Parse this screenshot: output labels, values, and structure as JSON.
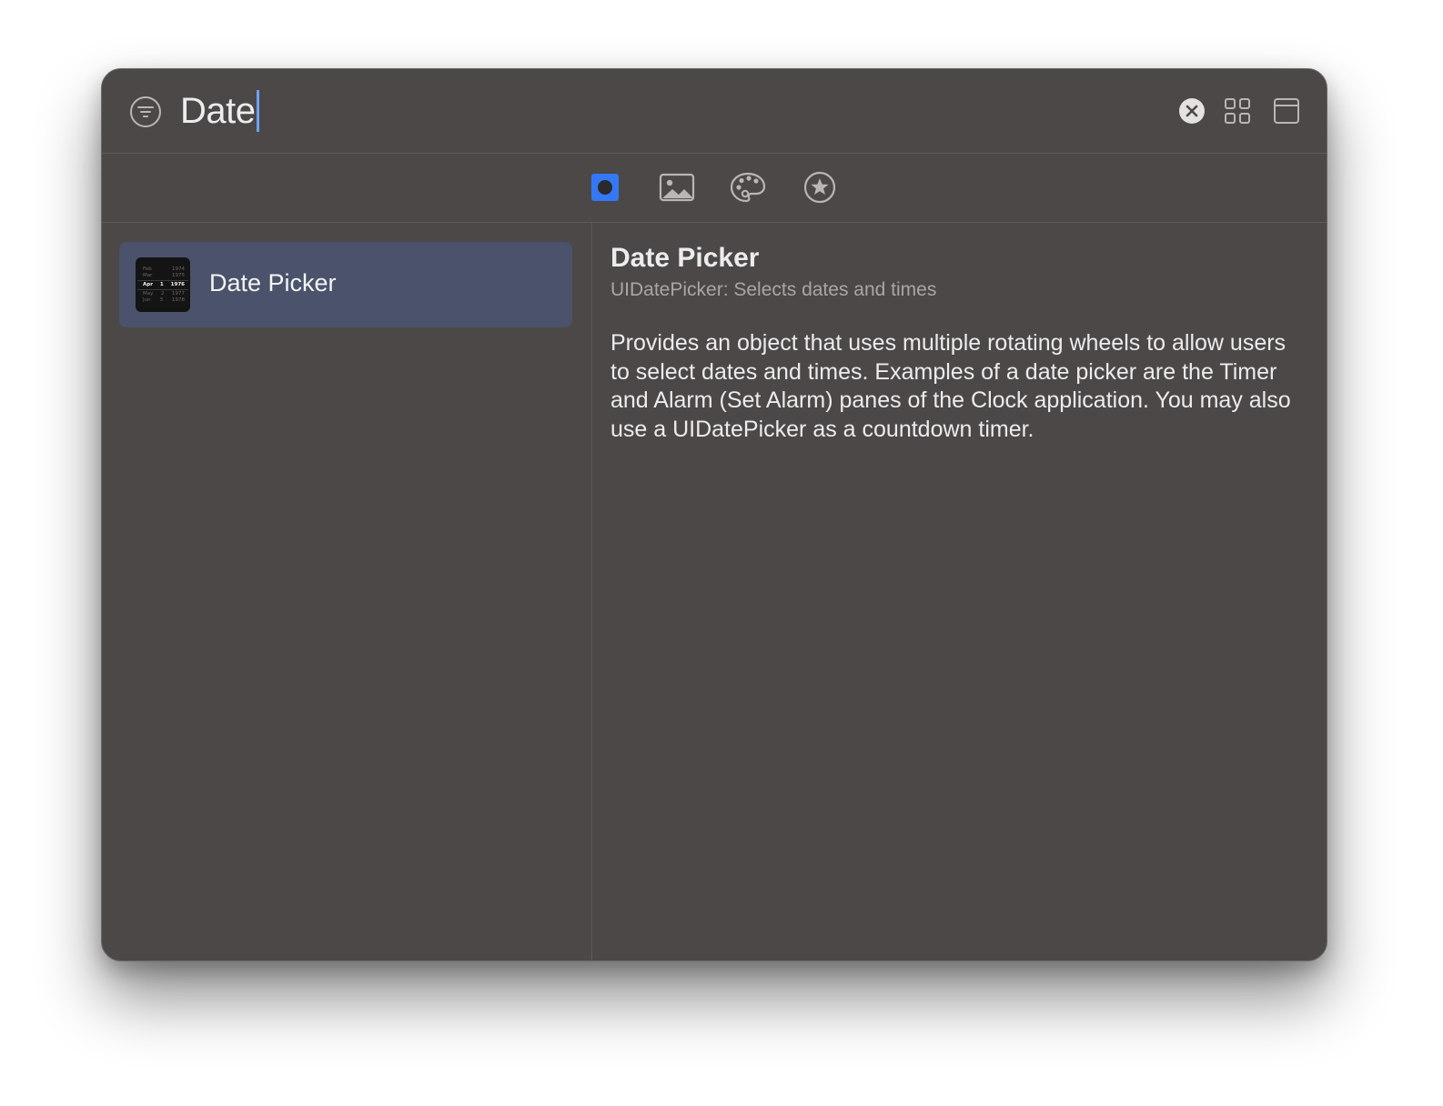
{
  "search": {
    "value": "Date"
  },
  "tabs": [
    {
      "icon": "objects-icon",
      "selected": true
    },
    {
      "icon": "image-icon",
      "selected": false
    },
    {
      "icon": "palette-icon",
      "selected": false
    },
    {
      "icon": "star-icon",
      "selected": false
    }
  ],
  "results": [
    {
      "label": "Date Picker",
      "thumbnail": {
        "rows": [
          {
            "month": "Feb",
            "day": "",
            "year": "1974"
          },
          {
            "month": "Mar",
            "day": "",
            "year": "1975"
          },
          {
            "month": "Apr",
            "day": "1",
            "year": "1976"
          },
          {
            "month": "May",
            "day": "2",
            "year": "1977"
          },
          {
            "month": "Jun",
            "day": "3",
            "year": "1978"
          }
        ]
      }
    }
  ],
  "detail": {
    "title": "Date Picker",
    "subtitle": "UIDatePicker: Selects dates and times",
    "body": "Provides an object that uses multiple rotating wheels to allow users to select dates and times. Examples of a date picker are the Timer and Alarm (Set Alarm) panes of the Clock application. You may also use a UIDatePicker as a countdown timer."
  },
  "colors": {
    "window_bg": "#4b4847",
    "selection_bg": "#4a536b",
    "accent": "#3478f6",
    "caret": "#6ea1f7",
    "icon": "#b9b6b5"
  }
}
